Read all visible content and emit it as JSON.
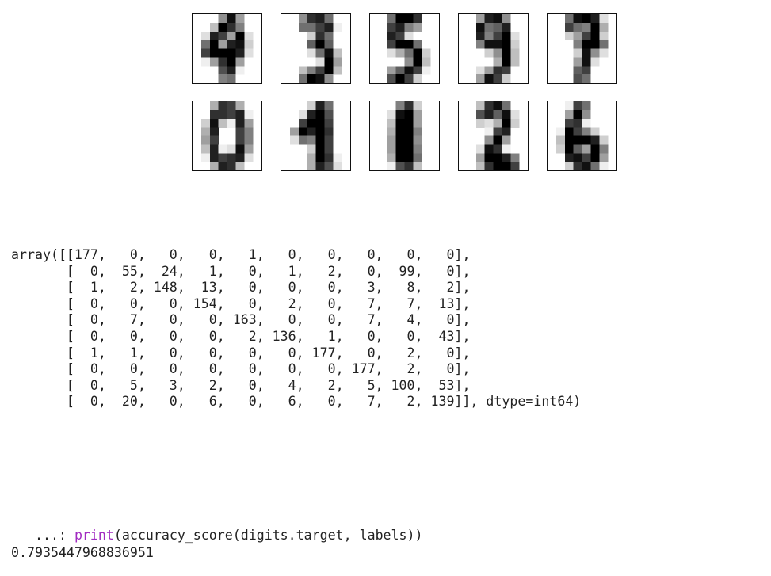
{
  "digit_grid": {
    "rows": [
      [
        "4",
        "3",
        "5",
        "9",
        "7"
      ],
      [
        "0",
        "4",
        "1",
        "2",
        "6"
      ]
    ]
  },
  "array_output": {
    "prefix": "array([[",
    "row_prefix": "[",
    "rows": [
      [
        177,
        0,
        0,
        0,
        1,
        0,
        0,
        0,
        0,
        0
      ],
      [
        0,
        55,
        24,
        1,
        0,
        1,
        2,
        0,
        99,
        0
      ],
      [
        1,
        2,
        148,
        13,
        0,
        0,
        0,
        3,
        8,
        2
      ],
      [
        0,
        0,
        0,
        154,
        0,
        2,
        0,
        7,
        7,
        13
      ],
      [
        0,
        7,
        0,
        0,
        163,
        0,
        0,
        7,
        4,
        0
      ],
      [
        0,
        0,
        0,
        0,
        2,
        136,
        1,
        0,
        0,
        43
      ],
      [
        1,
        1,
        0,
        0,
        0,
        0,
        177,
        0,
        2,
        0
      ],
      [
        0,
        0,
        0,
        0,
        0,
        0,
        0,
        177,
        2,
        0
      ],
      [
        0,
        5,
        3,
        2,
        0,
        4,
        2,
        5,
        100,
        53
      ],
      [
        0,
        20,
        0,
        6,
        0,
        6,
        0,
        7,
        2,
        139
      ]
    ],
    "suffix": "]], dtype=int64)"
  },
  "console": {
    "prompt": "   ...: ",
    "keyword": "print",
    "call_rest": "(accuracy_score(digits.target, labels))",
    "result": "0.7935447968836951",
    "keyword_color": "#a12ac1"
  }
}
